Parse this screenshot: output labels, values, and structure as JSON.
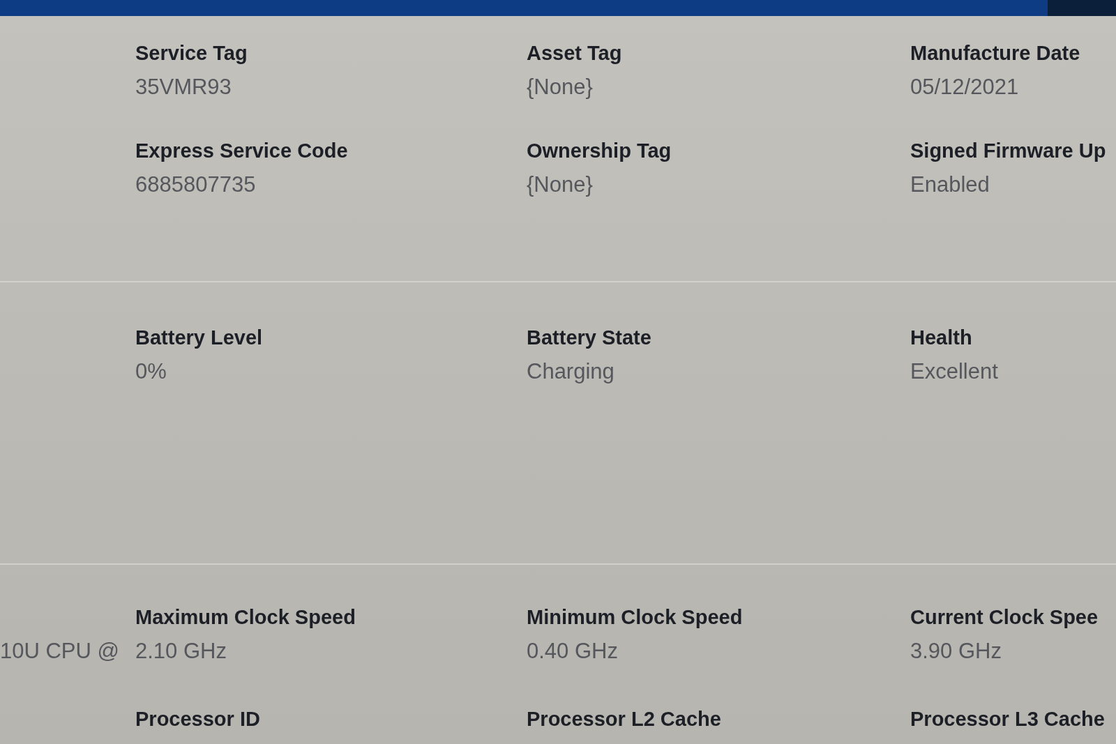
{
  "sections": [
    {
      "fields": [
        {
          "label": "Service Tag",
          "value": "35VMR93"
        },
        {
          "label": "Asset Tag",
          "value": "{None}"
        },
        {
          "label": "Manufacture Date",
          "value": "05/12/2021"
        },
        {
          "label": "Express Service Code",
          "value": "6885807735"
        },
        {
          "label": "Ownership Tag",
          "value": "{None}"
        },
        {
          "label": "Signed Firmware Up",
          "value": "Enabled"
        }
      ]
    },
    {
      "fields": [
        {
          "label": "Battery Level",
          "value": "0%"
        },
        {
          "label": "Battery State",
          "value": "Charging"
        },
        {
          "label": "Health",
          "value": "Excellent"
        }
      ]
    },
    {
      "cut_off_text": "10U CPU @",
      "fields": [
        {
          "label": "Maximum Clock Speed",
          "value": "2.10 GHz"
        },
        {
          "label": "Minimum Clock Speed",
          "value": "0.40 GHz"
        },
        {
          "label": "Current Clock Spee",
          "value": "3.90 GHz"
        },
        {
          "label": "Processor ID"
        },
        {
          "label": "Processor L2 Cache"
        },
        {
          "label": "Processor L3 Cache"
        }
      ]
    }
  ]
}
